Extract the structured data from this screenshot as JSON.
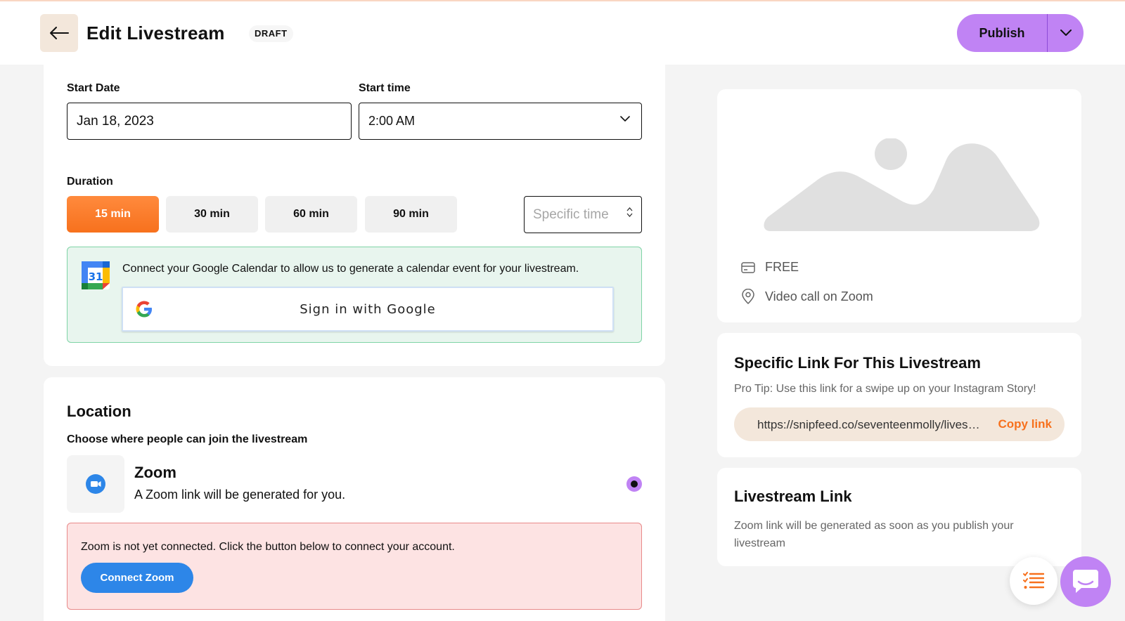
{
  "header": {
    "title": "Edit Livestream",
    "badge": "DRAFT",
    "publish_label": "Publish"
  },
  "schedule": {
    "start_date_label": "Start Date",
    "start_date_value": "Jan 18, 2023",
    "start_time_label": "Start time",
    "start_time_value": "2:00 AM"
  },
  "duration": {
    "label": "Duration",
    "options": [
      "15 min",
      "30 min",
      "60 min",
      "90 min"
    ],
    "selected": "15 min",
    "specific_placeholder": "Specific time"
  },
  "gcal": {
    "message": "Connect your Google Calendar to allow us to generate a calendar event for your livestream.",
    "calendar_day": "31",
    "signin_label": "Sign in with Google"
  },
  "location": {
    "title": "Location",
    "subtitle": "Choose where people can join the livestream",
    "zoom_title": "Zoom",
    "zoom_desc": "A Zoom link will be generated for you.",
    "warning": "Zoom is not yet connected. Click the button below to connect your account.",
    "connect_label": "Connect Zoom"
  },
  "preview": {
    "price": "FREE",
    "location": "Video call on Zoom"
  },
  "specific_link": {
    "title": "Specific Link For This Livestream",
    "tip": "Pro Tip: Use this link for a swipe up on your Instagram Story!",
    "url": "https://snipfeed.co/seventeenmolly/livestream",
    "copy_label": "Copy link"
  },
  "livestream_link": {
    "title": "Livestream Link",
    "text": "Zoom link will be generated as soon as you publish your livestream"
  },
  "colors": {
    "accent_orange": "#f7711d",
    "accent_purple": "#c083f4",
    "zoom_blue": "#2d86e8"
  }
}
